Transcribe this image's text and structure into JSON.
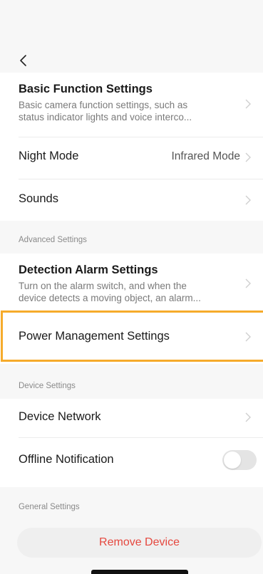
{
  "nav": {
    "back_icon": "chevron-left-icon"
  },
  "basic": {
    "title": "Basic Function Settings",
    "desc_line1": "Basic camera function settings, such as",
    "desc_line2": "status indicator lights and voice interco..."
  },
  "night_mode": {
    "title": "Night Mode",
    "value": "Infrared Mode"
  },
  "sounds": {
    "title": "Sounds"
  },
  "advanced": {
    "label": "Advanced Settings",
    "detection_title": "Detection Alarm Settings",
    "detection_desc_line1": "Turn on the alarm switch, and when the",
    "detection_desc_line2": "device detects a moving object, an alarm...",
    "power_title": "Power Management Settings"
  },
  "device": {
    "label": "Device Settings",
    "network_title": "Device Network",
    "offline_title": "Offline Notification",
    "offline_enabled": false
  },
  "general": {
    "label": "General Settings",
    "remove_label": "Remove Device"
  },
  "colors": {
    "accent_highlight": "#f6ab2b",
    "danger": "#e5483f"
  }
}
